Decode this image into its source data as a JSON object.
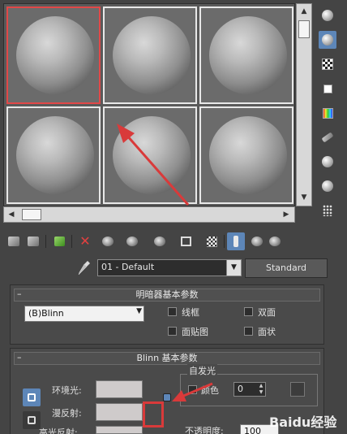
{
  "material_name": "01 - Default",
  "material_type": "Standard",
  "shader_rollout": {
    "title": "明暗器基本参数",
    "shader": "(B)Blinn",
    "options": [
      {
        "label": "线框",
        "checked": false
      },
      {
        "label": "双面",
        "checked": false
      },
      {
        "label": "面贴图",
        "checked": false
      },
      {
        "label": "面状",
        "checked": false
      }
    ]
  },
  "blinn_rollout": {
    "title": "Blinn 基本参数",
    "ambient_label": "环境光:",
    "diffuse_label": "漫反射:",
    "specular_label": "高光反射:",
    "self_illum_title": "自发光",
    "color_label": "颜色",
    "color_value": "0",
    "opacity_label": "不透明度:",
    "opacity_value": "100"
  },
  "watermark": "Baidu经验",
  "colors": {
    "accent": "#5d86b8",
    "selection": "#e24848",
    "annotation": "#d93a3a"
  }
}
